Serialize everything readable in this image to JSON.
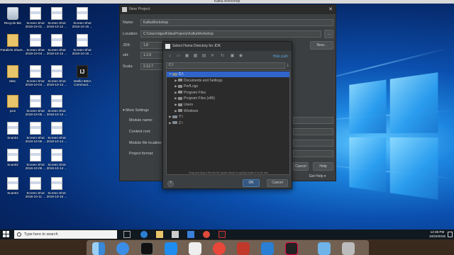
{
  "window_title": "Kafka Workshop",
  "desktop_icons": [
    {
      "label": "Recycle Bin",
      "kind": "bin"
    },
    {
      "label": "Screen Shot 2018-10-01 ...",
      "kind": "thumb"
    },
    {
      "label": "Screen Shot 2018-10-12 ...",
      "kind": "thumb"
    },
    {
      "label": "Screen Shot 2018-10-15 ...",
      "kind": "thumb"
    },
    {
      "label": "Parallels Share...",
      "kind": "folder"
    },
    {
      "label": "Screen Shot 2018-10-04 ...",
      "kind": "thumb"
    },
    {
      "label": "Screen Shot 2018-10-12 ...",
      "kind": "thumb"
    },
    {
      "label": "Screen Shot 2018-10-15 ...",
      "kind": "thumb"
    },
    {
      "label": "Misc",
      "kind": "folder"
    },
    {
      "label": "Screen Shot 2018-10-04 ...",
      "kind": "thumb"
    },
    {
      "label": "Screen Shot 2018-10-13 ...",
      "kind": "thumb"
    },
    {
      "label": "IntelliJ IDEA Communi...",
      "kind": "idea"
    },
    {
      "label": "pics",
      "kind": "folder"
    },
    {
      "label": "Screen Shot 2018-10-05 ...",
      "kind": "thumb"
    },
    {
      "label": "Screen Shot 2018-10-13 ...",
      "kind": "thumb"
    },
    {
      "label": "Scan01",
      "kind": "thumb"
    },
    {
      "label": "Screen Shot 2018-10-06 ...",
      "kind": "thumb"
    },
    {
      "label": "Screen Shot 2018-10-14 ...",
      "kind": "thumb"
    },
    {
      "label": "Scan02",
      "kind": "thumb"
    },
    {
      "label": "Screen Shot 2018-10-09 ...",
      "kind": "thumb"
    },
    {
      "label": "Screen Shot 2018-10-14 ...",
      "kind": "thumb"
    },
    {
      "label": "Scan03",
      "kind": "thumb"
    },
    {
      "label": "Screen Shot 2018-10-11 ...",
      "kind": "thumb"
    },
    {
      "label": "Screen Shot 2018-10-15 ...",
      "kind": "thumb"
    }
  ],
  "new_project": {
    "title": "New Project",
    "name_label": "Name:",
    "name_value": "KafkaWorkshop",
    "location_label": "Location:",
    "location_value": "C:\\Users\\dgedl\\IdeaProjects\\KafkaWorkshop",
    "browse_label": "...",
    "jdk_label": "JDK:",
    "jdk_value": "1.8",
    "jdk_new_label": "New...",
    "sbt_label": "sbt:",
    "sbt_value": "1.2.6",
    "scala_label": "Scala:",
    "scala_value": "2.12.7",
    "more_settings_label": "More Settings",
    "module_name_label": "Module name:",
    "content_root_label": "Content root:",
    "module_file_label": "Module file location:",
    "project_format_label": "Project format:",
    "cancel_label": "Cancel",
    "help_label": "Help",
    "get_help_label": "Get Help"
  },
  "jdk_dialog": {
    "title": "Select Home Directory for JDK",
    "hide_path_label": "Hide path",
    "path_value": "C:\\",
    "tree": [
      {
        "label": "C:\\",
        "level": 0,
        "expanded": true,
        "selected": true,
        "type": "drive"
      },
      {
        "label": "Documents and Settings",
        "level": 1,
        "expanded": false,
        "selected": false,
        "type": "folder"
      },
      {
        "label": "PerfLogs",
        "level": 1,
        "expanded": false,
        "selected": false,
        "type": "folder"
      },
      {
        "label": "Program Files",
        "level": 1,
        "expanded": false,
        "selected": false,
        "type": "folder"
      },
      {
        "label": "Program Files (x86)",
        "level": 1,
        "expanded": false,
        "selected": false,
        "type": "folder"
      },
      {
        "label": "Users",
        "level": 1,
        "expanded": false,
        "selected": false,
        "type": "folder"
      },
      {
        "label": "Windows",
        "level": 1,
        "expanded": false,
        "selected": false,
        "type": "folder"
      },
      {
        "label": "Y:\\",
        "level": 0,
        "expanded": false,
        "selected": false,
        "type": "drive"
      },
      {
        "label": "Z:\\",
        "level": 0,
        "expanded": false,
        "selected": false,
        "type": "drive"
      }
    ],
    "drag_hint": "Drag and drop a file into the space above to quickly locate it in the tree",
    "ok_label": "OK",
    "cancel_label": "Cancel",
    "help_glyph": "?"
  },
  "taskbar": {
    "search_placeholder": "Type here to search",
    "time": "12:38 PM",
    "date": "10/22/2018"
  },
  "colors": {
    "ide_bg": "#3c3f41",
    "selection": "#2f65ca",
    "ok_button": "#365880",
    "link": "#5a9fd4"
  }
}
